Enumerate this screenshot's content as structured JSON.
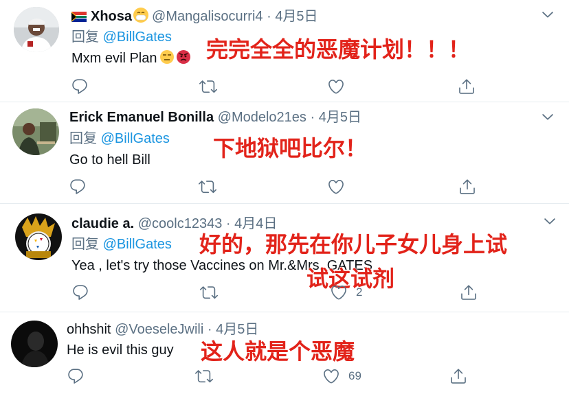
{
  "tweets": [
    {
      "name": "Xhosa",
      "handle": "@Mangalisocurri4",
      "dot": "·",
      "date": "4月5日",
      "reply_prefix": "回复",
      "reply_to": "@BillGates",
      "text": "Mxm evil Plan",
      "annotation": "完完全全的恶魔计划！！！",
      "like_count": ""
    },
    {
      "name": "Erick Emanuel Bonilla",
      "handle": "@Modelo21es",
      "dot": "·",
      "date": "4月5日",
      "reply_prefix": "回复",
      "reply_to": "@BillGates",
      "text": "Go to hell Bill",
      "annotation": "下地狱吧比尔！",
      "like_count": ""
    },
    {
      "name": "claudie a.",
      "handle": "@coolc12343",
      "dot": "·",
      "date": "4月4日",
      "reply_prefix": "回复",
      "reply_to": "@BillGates",
      "text": "Yea , let's try those Vaccines on Mr.&Mrs. GATES",
      "annotation_line1": "好的，那先在你儿子女儿身上试",
      "annotation_line2": "试这试剂",
      "like_count": "2"
    },
    {
      "name": "ohhshit",
      "handle": "@VoeseleJwili",
      "dot": "·",
      "date": "4月5日",
      "text": "He is evil this guy",
      "annotation": "这人就是个恶魔",
      "like_count": "69"
    }
  ],
  "colors": {
    "mention": "#1b95e0",
    "secondary": "#5b7083",
    "annotation": "#e2231a"
  },
  "icons": [
    "reply-icon",
    "retweet-icon",
    "like-icon",
    "share-icon",
    "caret-down-icon"
  ]
}
